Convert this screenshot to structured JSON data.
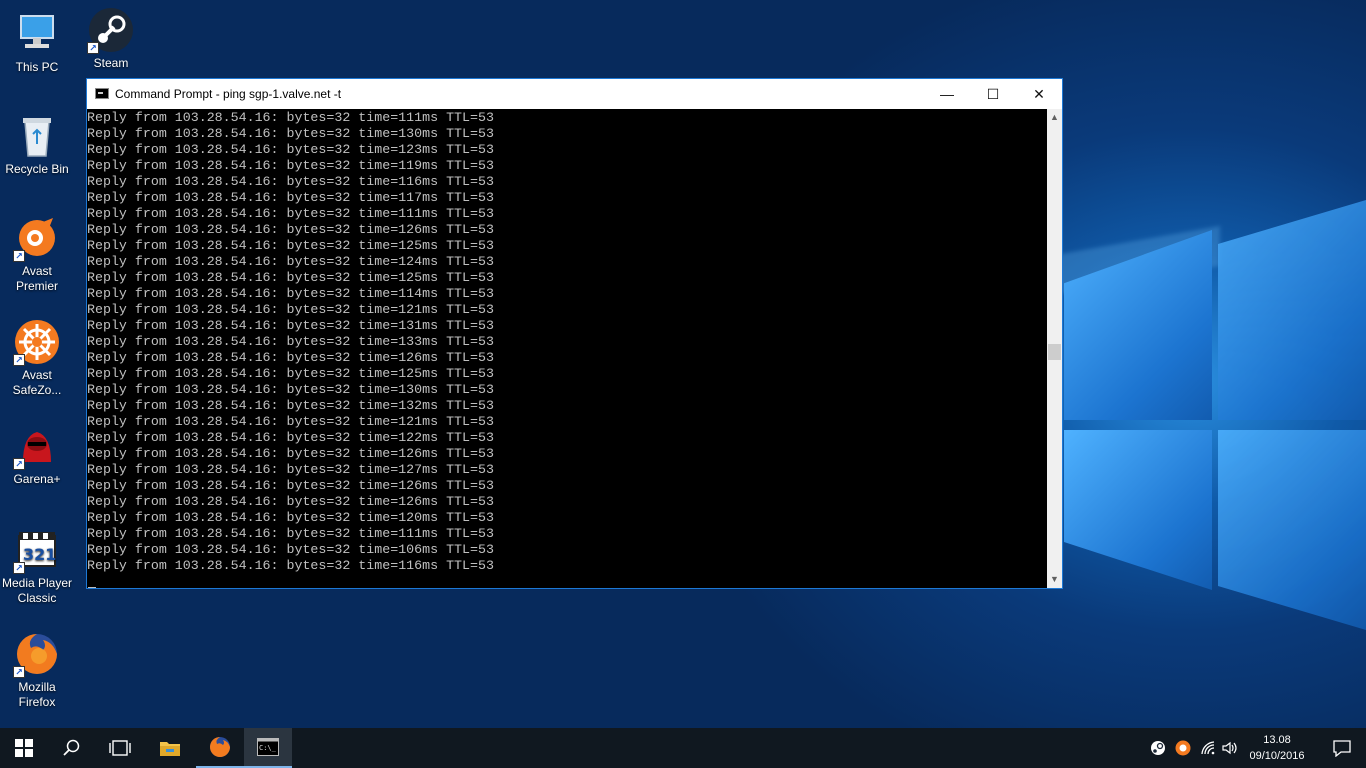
{
  "desktop": {
    "icons": [
      {
        "label": "This PC",
        "icon": "this-pc-icon"
      },
      {
        "label": "Steam",
        "icon": "steam-icon"
      },
      {
        "label": "Recycle Bin",
        "icon": "recycle-bin-icon"
      },
      {
        "label": "Avast\nPremier",
        "icon": "avast-icon"
      },
      {
        "label": "Avast\nSafeZo...",
        "icon": "avast-safezone-icon"
      },
      {
        "label": "Garena+",
        "icon": "garena-icon"
      },
      {
        "label": "Media Player\nClassic",
        "icon": "media-player-classic-icon"
      },
      {
        "label": "Mozilla\nFirefox",
        "icon": "firefox-icon"
      }
    ]
  },
  "window": {
    "title": "Command Prompt - ping  sgp-1.valve.net -t",
    "minimize": "—",
    "maximize": "☐",
    "close": "✕",
    "console_lines": [
      "Reply from 103.28.54.16: bytes=32 time=111ms TTL=53",
      "Reply from 103.28.54.16: bytes=32 time=130ms TTL=53",
      "Reply from 103.28.54.16: bytes=32 time=123ms TTL=53",
      "Reply from 103.28.54.16: bytes=32 time=119ms TTL=53",
      "Reply from 103.28.54.16: bytes=32 time=116ms TTL=53",
      "Reply from 103.28.54.16: bytes=32 time=117ms TTL=53",
      "Reply from 103.28.54.16: bytes=32 time=111ms TTL=53",
      "Reply from 103.28.54.16: bytes=32 time=126ms TTL=53",
      "Reply from 103.28.54.16: bytes=32 time=125ms TTL=53",
      "Reply from 103.28.54.16: bytes=32 time=124ms TTL=53",
      "Reply from 103.28.54.16: bytes=32 time=125ms TTL=53",
      "Reply from 103.28.54.16: bytes=32 time=114ms TTL=53",
      "Reply from 103.28.54.16: bytes=32 time=121ms TTL=53",
      "Reply from 103.28.54.16: bytes=32 time=131ms TTL=53",
      "Reply from 103.28.54.16: bytes=32 time=133ms TTL=53",
      "Reply from 103.28.54.16: bytes=32 time=126ms TTL=53",
      "Reply from 103.28.54.16: bytes=32 time=125ms TTL=53",
      "Reply from 103.28.54.16: bytes=32 time=130ms TTL=53",
      "Reply from 103.28.54.16: bytes=32 time=132ms TTL=53",
      "Reply from 103.28.54.16: bytes=32 time=121ms TTL=53",
      "Reply from 103.28.54.16: bytes=32 time=122ms TTL=53",
      "Reply from 103.28.54.16: bytes=32 time=126ms TTL=53",
      "Reply from 103.28.54.16: bytes=32 time=127ms TTL=53",
      "Reply from 103.28.54.16: bytes=32 time=126ms TTL=53",
      "Reply from 103.28.54.16: bytes=32 time=126ms TTL=53",
      "Reply from 103.28.54.16: bytes=32 time=120ms TTL=53",
      "Reply from 103.28.54.16: bytes=32 time=111ms TTL=53",
      "Reply from 103.28.54.16: bytes=32 time=106ms TTL=53",
      "Reply from 103.28.54.16: bytes=32 time=116ms TTL=53"
    ]
  },
  "taskbar": {
    "start_icon": "windows-start-icon",
    "search_icon": "search-icon",
    "task_view_icon": "task-view-icon",
    "pinned": [
      "file-explorer-icon",
      "firefox-icon",
      "command-prompt-icon"
    ],
    "tray": [
      "steam-tray-icon",
      "avast-tray-icon",
      "wifi-icon",
      "volume-icon"
    ],
    "time": "13.08",
    "date": "09/10/2016",
    "notifications_icon": "action-center-icon"
  },
  "colors": {
    "console_bg": "#000000",
    "console_fg": "#c0c0c0",
    "window_border": "#1d79d6",
    "taskbar_bg": "#101820"
  }
}
